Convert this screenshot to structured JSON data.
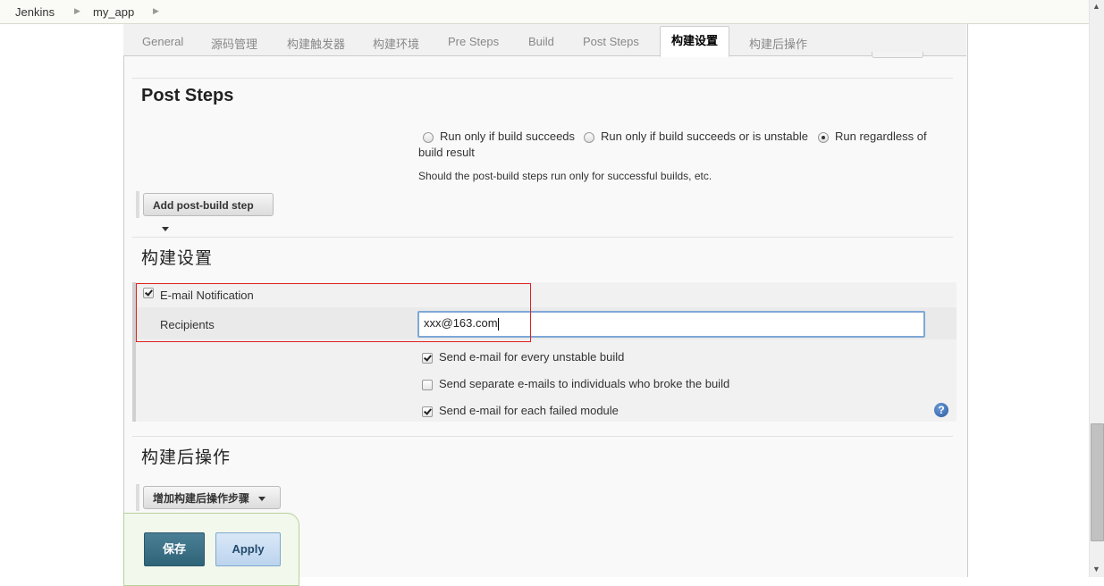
{
  "breadcrumb": {
    "items": [
      "Jenkins",
      "my_app"
    ]
  },
  "tabs": [
    {
      "label": "General"
    },
    {
      "label": "源码管理"
    },
    {
      "label": "构建触发器"
    },
    {
      "label": "构建环境"
    },
    {
      "label": "Pre Steps"
    },
    {
      "label": "Build"
    },
    {
      "label": "Post Steps"
    },
    {
      "label": "构建设置",
      "active": true
    },
    {
      "label": "构建后操作"
    }
  ],
  "post_steps": {
    "title": "Post Steps",
    "radio_options": [
      {
        "label": "Run only if build succeeds",
        "checked": false
      },
      {
        "label": "Run only if build succeeds or is unstable",
        "checked": false
      },
      {
        "label": "Run regardless of",
        "checked": true
      }
    ],
    "radio_wrap": "build result",
    "description": "Should the post-build steps run only for successful builds, etc.",
    "add_button": "Add post-build step"
  },
  "build_settings": {
    "title": "构建设置",
    "email_notification": {
      "label": "E-mail Notification",
      "checked": true
    },
    "recipients_label": "Recipients",
    "recipients_value": "xxx@163.com",
    "options": [
      {
        "label": "Send e-mail for every unstable build",
        "checked": true
      },
      {
        "label": "Send separate e-mails to individuals who broke the build",
        "checked": false
      },
      {
        "label": "Send e-mail for each failed module",
        "checked": true
      }
    ],
    "help_icon": "?"
  },
  "post_build": {
    "title": "构建后操作",
    "add_button": "增加构建后操作步骤"
  },
  "footer": {
    "save_label": "保存",
    "apply_label": "Apply"
  },
  "icons": {
    "breadcrumb_separator": "▶",
    "scroll_up": "▲",
    "scroll_down": "▼"
  }
}
